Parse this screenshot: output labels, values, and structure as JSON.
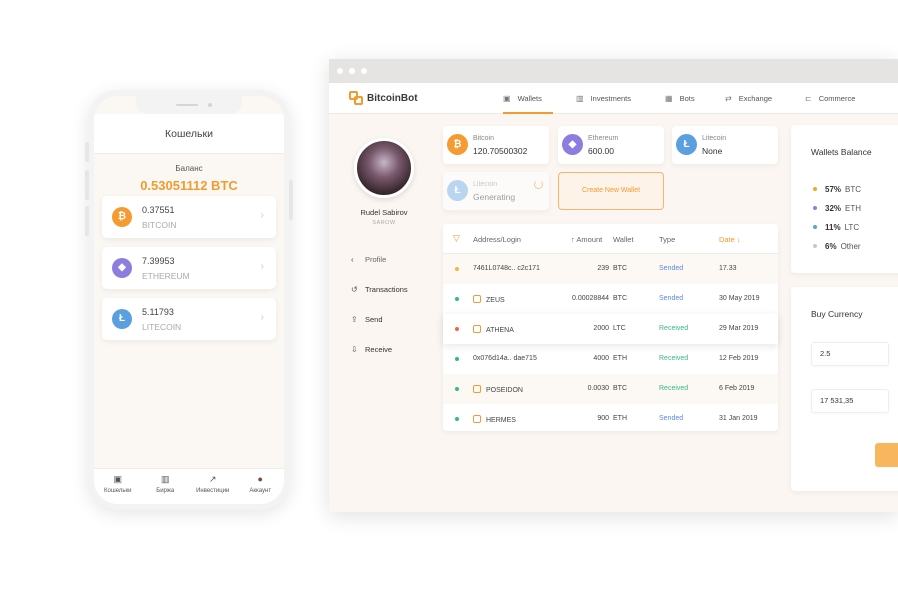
{
  "phone": {
    "title": "Кошельки",
    "balance_label": "Баланс",
    "balance_value": "0.53051112 BTC",
    "wallets": [
      {
        "amount": "0.37551",
        "name": "BITCOIN",
        "icon": "bitcoin-icon",
        "symbol": "₿"
      },
      {
        "amount": "7.39953",
        "name": "ETHEREUM",
        "icon": "ethereum-icon",
        "symbol": "◆"
      },
      {
        "amount": "5.11793",
        "name": "LITECOIN",
        "icon": "litecoin-icon",
        "symbol": "Ł"
      }
    ],
    "tabs": [
      {
        "label": "Кошельки",
        "icon": "wallet-icon",
        "glyph": "▣"
      },
      {
        "label": "Биржа",
        "icon": "chart-bars-icon",
        "glyph": "▥"
      },
      {
        "label": "Инвестиции",
        "icon": "trend-icon",
        "glyph": "↗"
      },
      {
        "label": "Аккаунт",
        "icon": "account-avatar-icon",
        "glyph": "●"
      }
    ]
  },
  "browser": {
    "logo": "BitcoinBot",
    "nav": [
      {
        "label": "Wallets",
        "icon": "wallet-icon",
        "glyph": "▣",
        "active": true
      },
      {
        "label": "Investments",
        "icon": "bar-chart-icon",
        "glyph": "▥",
        "active": false
      },
      {
        "label": "Bots",
        "icon": "bots-icon",
        "glyph": "▦",
        "active": false
      },
      {
        "label": "Exchange",
        "icon": "exchange-icon",
        "glyph": "⇄",
        "active": false
      },
      {
        "label": "Commerce",
        "icon": "cart-icon",
        "glyph": "⊏",
        "active": false
      }
    ],
    "user": {
      "name": "Rudel Sabirov",
      "subtitle": "SAROW"
    },
    "menu": [
      {
        "label": "Profile",
        "icon": "chevron-left-icon",
        "glyph": "‹"
      },
      {
        "label": "Transactions",
        "icon": "history-icon",
        "glyph": "↺"
      },
      {
        "label": "Send",
        "icon": "upload-icon",
        "glyph": "⇪"
      },
      {
        "label": "Receive",
        "icon": "download-icon",
        "glyph": "⇩"
      }
    ],
    "wallet_cards": [
      {
        "label": "Bitcoin",
        "value": "120.70500302",
        "icon": "bitcoin-icon",
        "symbol": "₿"
      },
      {
        "label": "Ethereum",
        "value": "600.00",
        "icon": "ethereum-icon",
        "symbol": "◆"
      },
      {
        "label": "Litecoin",
        "value": "None",
        "icon": "litecoin-icon",
        "symbol": "Ł"
      },
      {
        "label": "Litecoin",
        "value": "Generating",
        "icon": "litecoin-icon",
        "symbol": "Ł"
      }
    ],
    "create_wallet": "Create New Wallet",
    "table": {
      "filter_icon": "filter-icon",
      "headers": {
        "address": "Address/Login",
        "amount": "↑ Amount",
        "wallet": "Wallet",
        "type": "Type",
        "date": "Date ↓"
      },
      "rows": [
        {
          "address": "7461L0748c.. c2c171",
          "amount": "239",
          "wallet": "BTC",
          "type": "Sended",
          "date": "17.33",
          "dot": "#f5b63c",
          "bot": false
        },
        {
          "address": "ZEUS",
          "amount": "0.00028844",
          "wallet": "BTC",
          "type": "Sended",
          "date": "30 May 2019",
          "dot": "#35b88a",
          "bot": true
        },
        {
          "address": "ATHENA",
          "amount": "2000",
          "wallet": "LTC",
          "type": "Received",
          "date": "29 Mar 2019",
          "dot": "#f0683c",
          "bot": true
        },
        {
          "address": "0x076d14a.. dae715",
          "amount": "4000",
          "wallet": "ETH",
          "type": "Received",
          "date": "12 Feb 2019",
          "dot": "#35b88a",
          "bot": false
        },
        {
          "address": "POSEIDON",
          "amount": "0.0030",
          "wallet": "BTC",
          "type": "Received",
          "date": "6 Feb 2019",
          "dot": "#35b88a",
          "bot": true
        },
        {
          "address": "HERMES",
          "amount": "900",
          "wallet": "ETH",
          "type": "Sended",
          "date": "31 Jan 2019",
          "dot": "#35b88a",
          "bot": true
        }
      ]
    },
    "wallets_balance": {
      "title": "Wallets Balance",
      "items": [
        {
          "pct": "57%",
          "coin": "BTC",
          "color": "#f5a623"
        },
        {
          "pct": "32%",
          "coin": "ETH",
          "color": "#8d7dde"
        },
        {
          "pct": "11%",
          "coin": "LTC",
          "color": "#5aa0de"
        },
        {
          "pct": "6%",
          "coin": "Other",
          "color": "#c8c8c8"
        }
      ]
    },
    "buy_currency": {
      "title": "Buy Currency",
      "amount": "2.5",
      "total": "17 531,35"
    }
  }
}
